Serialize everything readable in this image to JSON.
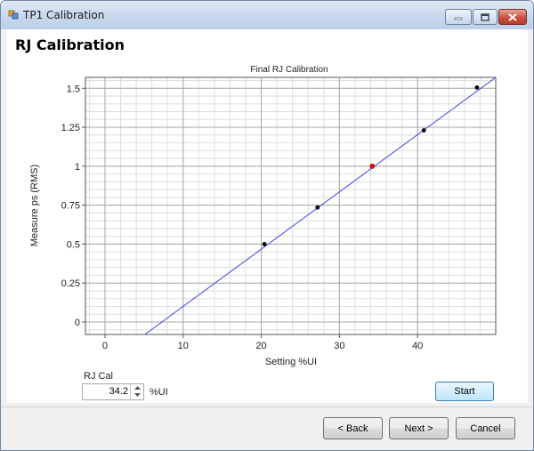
{
  "window": {
    "title": "TP1 Calibration",
    "controls": [
      "minimize-icon",
      "maximize-icon",
      "close-icon"
    ]
  },
  "page": {
    "title": "RJ Calibration"
  },
  "chart_data": {
    "type": "scatter",
    "title": "Final RJ Calibration",
    "xlabel": "Setting %UI",
    "ylabel": "Measure ps (RMS)",
    "xlim": [
      -2.5,
      50
    ],
    "ylim": [
      -0.08,
      1.57
    ],
    "xticks": [
      0,
      10,
      20,
      30,
      40
    ],
    "yticks": [
      0,
      0.25,
      0.5,
      0.75,
      1,
      1.25,
      1.5
    ],
    "ytick_labels": [
      "0",
      "0.25",
      "0.5",
      "0.75",
      "1",
      "1.25",
      "1.5"
    ],
    "grid": true,
    "series": [
      {
        "type": "scatter",
        "color": "#000000",
        "x": [
          20.4,
          27.2,
          40.8,
          47.6
        ],
        "y": [
          0.5,
          0.735,
          1.23,
          1.505
        ]
      },
      {
        "type": "scatter",
        "color": "#d01010",
        "x": [
          34.2
        ],
        "y": [
          1.0
        ]
      },
      {
        "type": "line",
        "color": "#3a46e8",
        "x": [
          5.1,
          50
        ],
        "y": [
          -0.08,
          1.57
        ]
      }
    ]
  },
  "controls": {
    "rj_cal_label": "RJ Cal",
    "rj_cal_value": "34.2",
    "rj_cal_unit": "%UI",
    "start_label": "Start"
  },
  "footer": {
    "back_label": "< Back",
    "next_label": "Next >",
    "cancel_label": "Cancel"
  }
}
